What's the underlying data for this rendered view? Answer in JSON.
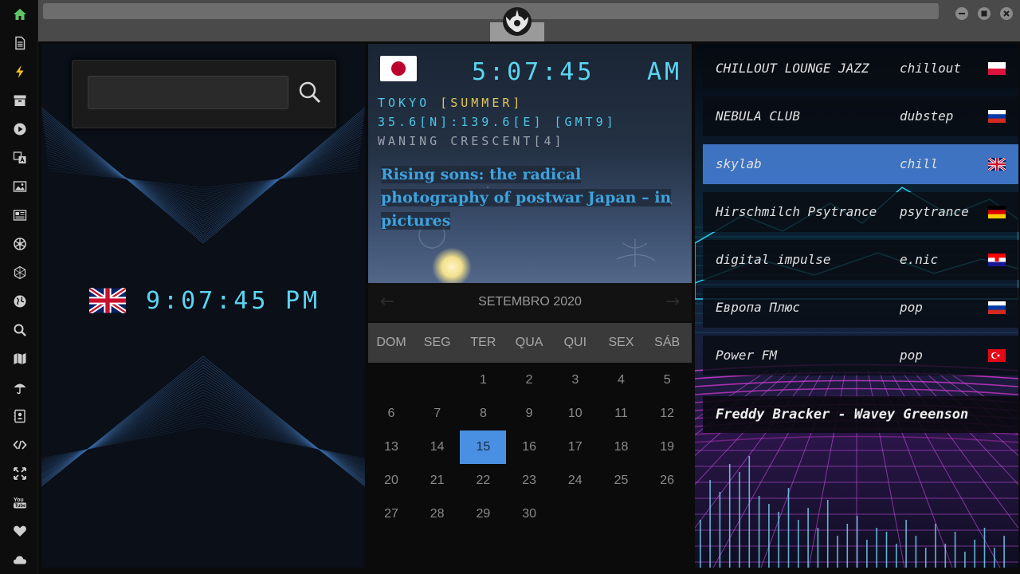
{
  "sidebar": {
    "icons": [
      "home-icon",
      "document-icon",
      "lightning-icon",
      "archive-icon",
      "play-icon",
      "translate-icon",
      "image-icon",
      "news-icon",
      "rebel-icon",
      "hexagon-icon",
      "globe-icon",
      "search-icon",
      "map-icon",
      "umbrella-icon",
      "contacts-icon",
      "code-icon",
      "expand-icon",
      "youtube-icon",
      "heart-icon",
      "cloud-icon"
    ],
    "active_color": "#5fc464"
  },
  "search": {
    "value": "",
    "placeholder": ""
  },
  "clock_london": {
    "flag": "uk",
    "time": "9:07:45",
    "ampm": "PM"
  },
  "clock_tokyo": {
    "flag": "japan",
    "time": "5:07:45",
    "ampm": "AM",
    "city": "TOKYO ",
    "season": "[SUMMER]",
    "coords": "35.6[N]:139.6[E] [GMT9]",
    "moon": "WANING CRESCENT[4]"
  },
  "news": {
    "headline": "Rising sons: the radical photography of postwar Japan – in pictures"
  },
  "calendar": {
    "month": "SETEMBRO 2020",
    "prev": "←",
    "next": "→",
    "dows": [
      "DOM",
      "SEG",
      "TER",
      "QUA",
      "QUI",
      "SEX",
      "SÁB"
    ],
    "weeks": [
      [
        "",
        "",
        "1",
        "2",
        "3",
        "4",
        "5"
      ],
      [
        "6",
        "7",
        "8",
        "9",
        "10",
        "11",
        "12"
      ],
      [
        "13",
        "14",
        "15",
        "16",
        "17",
        "18",
        "19"
      ],
      [
        "20",
        "21",
        "22",
        "23",
        "24",
        "25",
        "26"
      ],
      [
        "27",
        "28",
        "29",
        "30",
        "",
        "",
        ""
      ]
    ],
    "selected": "15",
    "selected_color": "#4a90e2"
  },
  "radio": {
    "stations": [
      {
        "name": "CHILLOUT LOUNGE JAZZ",
        "genre": "chillout",
        "flag": "poland"
      },
      {
        "name": "NEBULA CLUB",
        "genre": "dubstep",
        "flag": "russia"
      },
      {
        "name": "skylab",
        "genre": "chill",
        "flag": "uk"
      },
      {
        "name": "Hirschmilch Psytrance",
        "genre": "psytrance",
        "flag": "germany"
      },
      {
        "name": "digital impulse",
        "genre": "e.nic",
        "flag": "croatia"
      },
      {
        "name": "Европа Плюс",
        "genre": "pop",
        "flag": "russia"
      },
      {
        "name": "Power FM",
        "genre": "pop",
        "flag": "turkey"
      }
    ],
    "active_index": 2,
    "now_playing": "Freddy Bracker - Wavey Greenson"
  },
  "colors": {
    "digital_cyan": "#5ad6f2",
    "season_yellow": "#e3c55a",
    "headline_blue": "#3ea3e0"
  }
}
